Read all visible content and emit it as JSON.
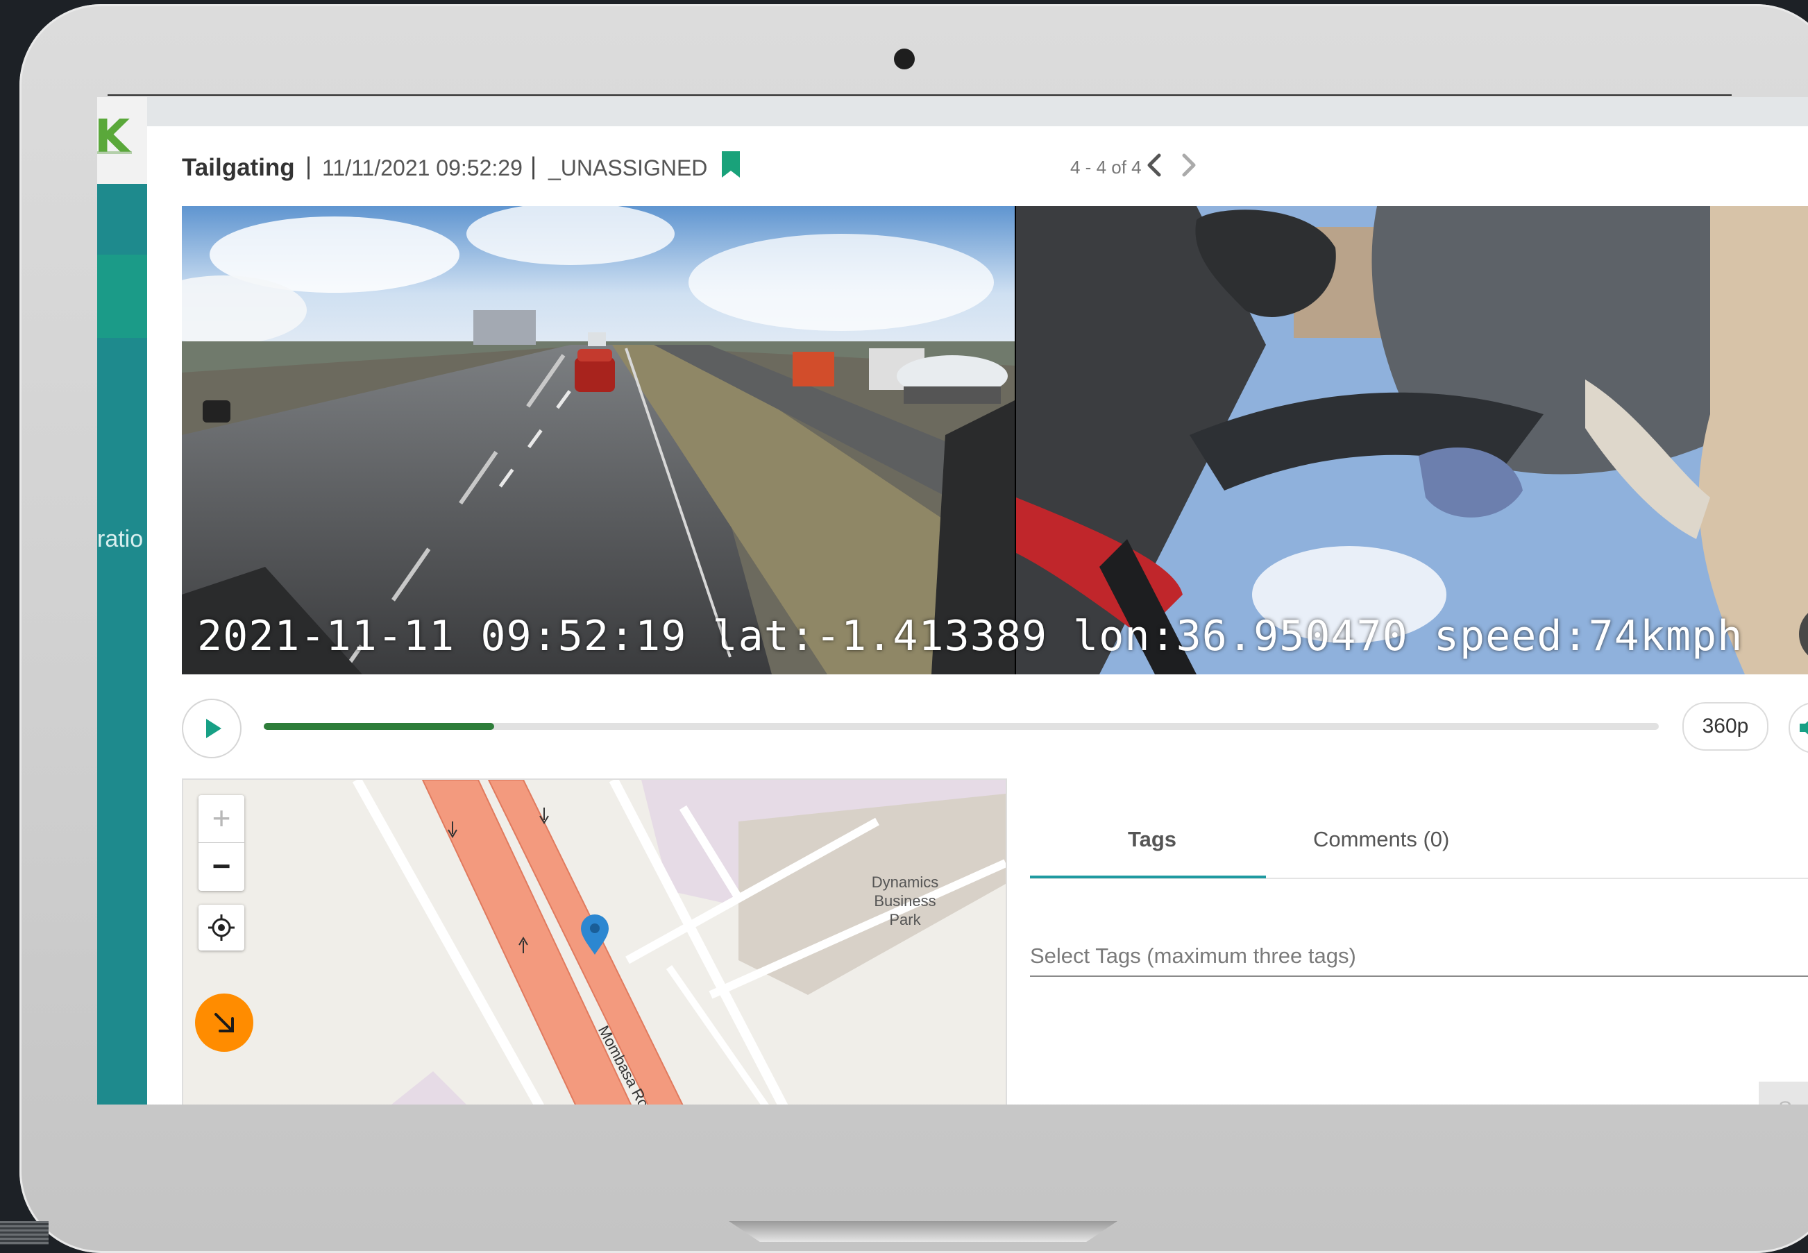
{
  "sidebar": {
    "logo": "K",
    "nav_partial_label": "ratio"
  },
  "modal": {
    "event_type": "Tailgating",
    "separator": "|",
    "datetime": "11/11/2021 09:52:29",
    "assignee": "_UNASSIGNED",
    "bookmark_color": "#19a27a",
    "pager": "4 - 4 of 4"
  },
  "video": {
    "overlay": "2021-11-11 09:52:19 lat:-1.413389 lon:36.950470 speed:74kmph",
    "progress": 0.165,
    "quality": "360p"
  },
  "map": {
    "zoom_in": "+",
    "zoom_out": "−",
    "place_label": "Dynamics Business Park",
    "road_label": "Mombasa Road",
    "heading_color": "#ff8c00",
    "marker_color": "#2c87d1"
  },
  "tabs": {
    "tags": "Tags",
    "comments": "Comments (0)",
    "accent": "#1f9aa0"
  },
  "tags_form": {
    "placeholder": "Select Tags (maximum three tags)",
    "save_label": "Sav"
  }
}
